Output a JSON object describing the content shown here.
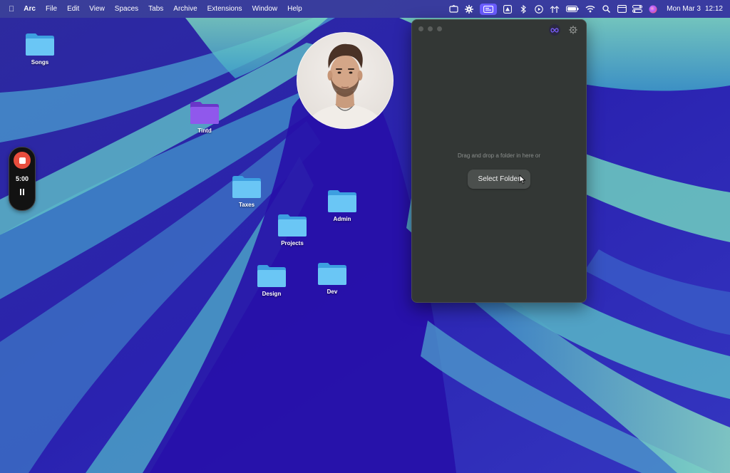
{
  "menubar": {
    "apple": "",
    "app_name": "Arc",
    "menus": [
      "File",
      "Edit",
      "View",
      "Spaces",
      "Tabs",
      "Archive",
      "Extensions",
      "Window",
      "Help"
    ],
    "status_icons": [
      "hanger-icon",
      "gear-icon",
      "screen-record-icon",
      "drive-icon",
      "bluetooth-icon",
      "play-icon",
      "antenna-icon",
      "battery-icon",
      "wifi-icon",
      "search-icon",
      "display-icon",
      "control-center-icon",
      "siri-icon"
    ],
    "date": "Mon Mar 3",
    "time": "12:12"
  },
  "desktop": {
    "folders": [
      {
        "name": "Songs",
        "color": "#5ab8f0"
      },
      {
        "name": "Tintd",
        "color": "#8a4fe0"
      },
      {
        "name": "Taxes",
        "color": "#5ab8f0"
      },
      {
        "name": "Admin",
        "color": "#5ab8f0"
      },
      {
        "name": "Projects",
        "color": "#5ab8f0"
      },
      {
        "name": "Design",
        "color": "#5ab8f0"
      },
      {
        "name": "Dev",
        "color": "#5ab8f0"
      }
    ]
  },
  "recorder": {
    "time": "5:00",
    "stop_color": "#e84d3d"
  },
  "window": {
    "drop_text": "Drag and drop a folder in here or",
    "select_button": "Select Folder",
    "accent": "#7a5cff"
  }
}
